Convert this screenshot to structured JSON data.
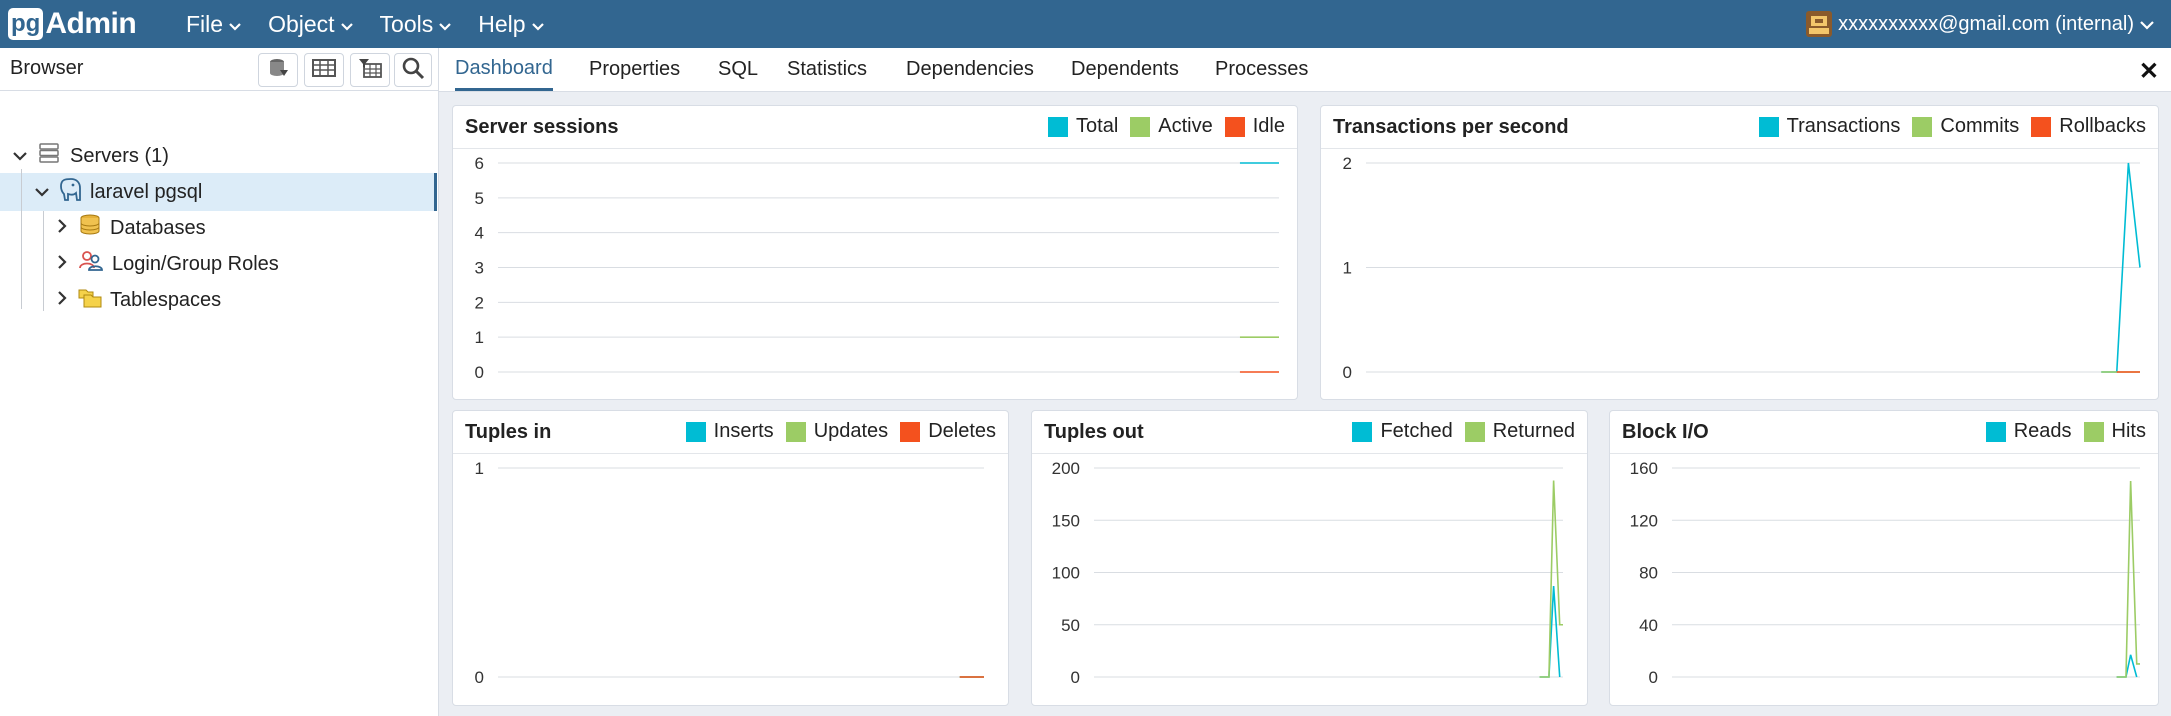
{
  "app": {
    "logo_pg": "pg",
    "logo_admin": "Admin",
    "brand_color": "#326690"
  },
  "menu": [
    "File",
    "Object",
    "Tools",
    "Help"
  ],
  "user": {
    "label": "xxxxxxxxxx@gmail.com (internal)"
  },
  "browser": {
    "title": "Browser",
    "tree": [
      {
        "label": "Servers (1)",
        "icon": "servers-icon"
      },
      {
        "label": "laravel pgsql",
        "icon": "elephant-icon",
        "selected": true
      },
      {
        "label": "Databases",
        "icon": "databases-icon"
      },
      {
        "label": "Login/Group Roles",
        "icon": "roles-icon"
      },
      {
        "label": "Tablespaces",
        "icon": "tablespaces-icon"
      }
    ]
  },
  "tabs": [
    "Dashboard",
    "Properties",
    "SQL",
    "Statistics",
    "Dependencies",
    "Dependents",
    "Processes"
  ],
  "active_tab": "Dashboard",
  "colors": {
    "cyan": "#00bcd4",
    "green": "#9ccc65",
    "red": "#f4511e"
  },
  "panels": {
    "sessions": {
      "title": "Server sessions",
      "legend": [
        "Total",
        "Active",
        "Idle"
      ]
    },
    "tps": {
      "title": "Transactions per second",
      "legend": [
        "Transactions",
        "Commits",
        "Rollbacks"
      ]
    },
    "tin": {
      "title": "Tuples in",
      "legend": [
        "Inserts",
        "Updates",
        "Deletes"
      ]
    },
    "tout": {
      "title": "Tuples out",
      "legend": [
        "Fetched",
        "Returned"
      ]
    },
    "bio": {
      "title": "Block I/O",
      "legend": [
        "Reads",
        "Hits"
      ]
    }
  },
  "chart_data": [
    {
      "type": "line",
      "title": "Server sessions",
      "yticks": [
        0,
        1,
        2,
        3,
        4,
        5,
        6
      ],
      "ylim": [
        0,
        6
      ],
      "series": [
        {
          "name": "Total",
          "x": [
            0.95,
            1.0
          ],
          "values": [
            6,
            6
          ]
        },
        {
          "name": "Active",
          "x": [
            0.95,
            1.0
          ],
          "values": [
            1,
            1
          ]
        },
        {
          "name": "Idle",
          "x": [
            0.95,
            1.0
          ],
          "values": [
            0,
            0
          ]
        }
      ]
    },
    {
      "type": "line",
      "title": "Transactions per second",
      "yticks": [
        0,
        1,
        2
      ],
      "ylim": [
        0,
        2
      ],
      "series": [
        {
          "name": "Transactions",
          "x": [
            0.95,
            0.97,
            0.985,
            1.0
          ],
          "values": [
            0,
            0,
            2,
            1
          ]
        },
        {
          "name": "Commits",
          "x": [
            0.95,
            1.0
          ],
          "values": [
            0,
            0
          ]
        },
        {
          "name": "Rollbacks",
          "x": [
            0.97,
            1.0
          ],
          "values": [
            0,
            0
          ]
        }
      ]
    },
    {
      "type": "line",
      "title": "Tuples in",
      "yticks": [
        0,
        1
      ],
      "ylim": [
        0,
        1
      ],
      "series": [
        {
          "name": "Inserts",
          "x": [
            0.95,
            1.0
          ],
          "values": [
            0,
            0
          ]
        },
        {
          "name": "Updates",
          "x": [
            0.95,
            1.0
          ],
          "values": [
            0,
            0
          ]
        },
        {
          "name": "Deletes",
          "x": [
            0.95,
            1.0
          ],
          "values": [
            0,
            0
          ]
        }
      ]
    },
    {
      "type": "line",
      "title": "Tuples out",
      "yticks": [
        0,
        50,
        100,
        150,
        200
      ],
      "ylim": [
        0,
        200
      ],
      "series": [
        {
          "name": "Fetched",
          "x": [
            0.95,
            0.97,
            0.98,
            0.993
          ],
          "values": [
            0,
            0,
            87,
            0
          ]
        },
        {
          "name": "Returned",
          "x": [
            0.95,
            0.97,
            0.98,
            0.993,
            1.0
          ],
          "values": [
            0,
            0,
            188,
            50,
            50
          ]
        }
      ]
    },
    {
      "type": "line",
      "title": "Block I/O",
      "yticks": [
        0,
        40,
        80,
        120,
        160
      ],
      "ylim": [
        0,
        160
      ],
      "series": [
        {
          "name": "Reads",
          "x": [
            0.95,
            0.97,
            0.98,
            0.993
          ],
          "values": [
            0,
            0,
            17,
            0
          ]
        },
        {
          "name": "Hits",
          "x": [
            0.95,
            0.97,
            0.98,
            0.993,
            1.0
          ],
          "values": [
            0,
            0,
            150,
            10,
            10
          ]
        }
      ]
    }
  ]
}
